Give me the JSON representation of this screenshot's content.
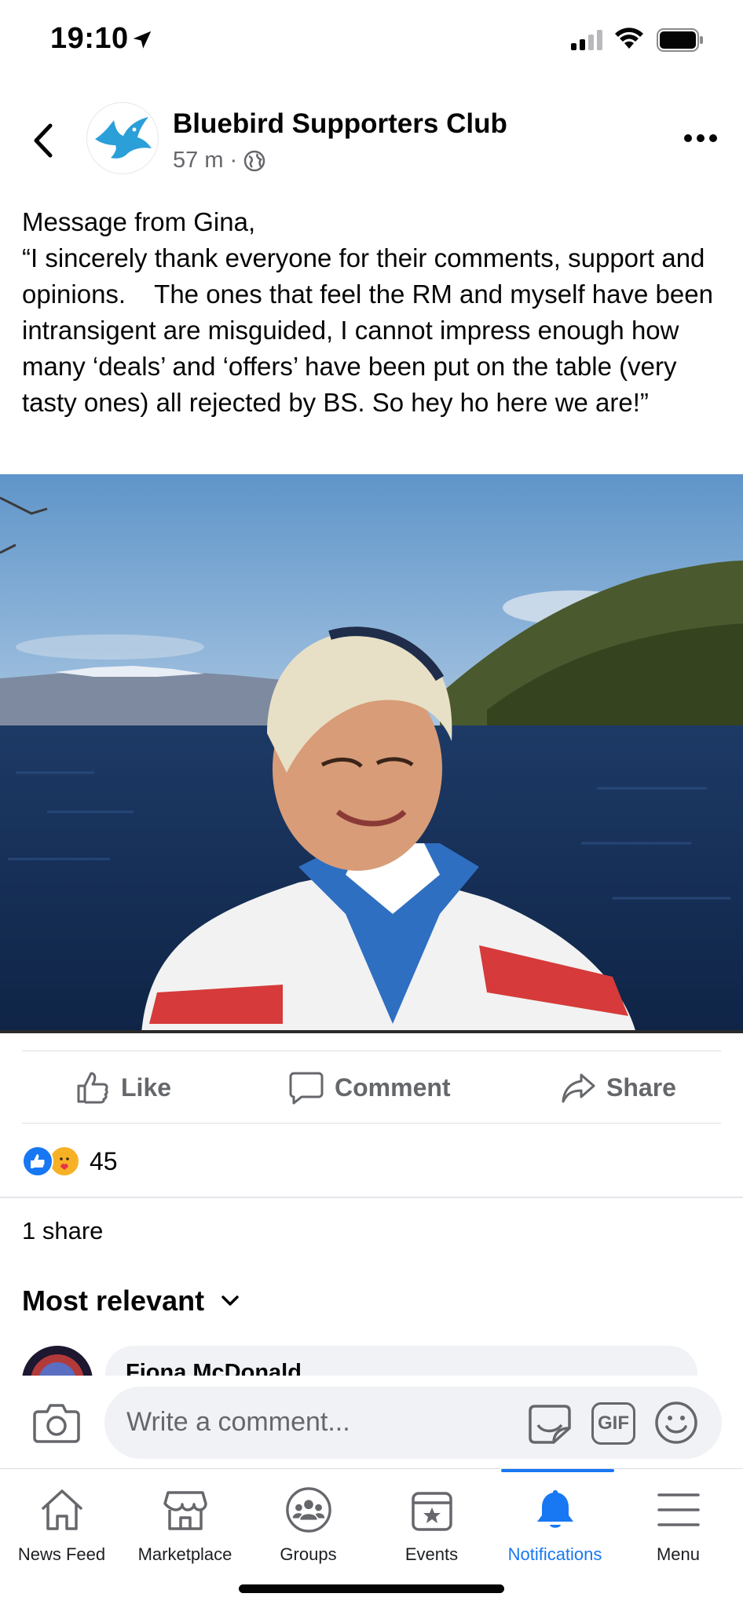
{
  "status_bar": {
    "time": "19:10"
  },
  "post": {
    "page_name": "Bluebird Supporters Club",
    "time_ago": "57 m",
    "separator": "·",
    "text": "Message from Gina,\n“I sincerely thank everyone for their comments, support and opinions.    The ones that feel the RM and myself have been intransigent are misguided, I cannot impress enough how many ‘deals’ and ‘offers’ have been put on the table (very tasty ones) all rejected by BS. So hey ho here we are!”"
  },
  "actions": {
    "like": "Like",
    "comment": "Comment",
    "share": "Share"
  },
  "reactions": {
    "count": "45"
  },
  "shares": "1 share",
  "comments": {
    "sort_label": "Most relevant",
    "first_author": "Fiona McDonald"
  },
  "composer": {
    "placeholder": "Write a comment...",
    "gif_label": "GIF"
  },
  "nav": {
    "items": [
      {
        "label": "News Feed",
        "icon": "home-icon"
      },
      {
        "label": "Marketplace",
        "icon": "marketplace-icon"
      },
      {
        "label": "Groups",
        "icon": "groups-icon"
      },
      {
        "label": "Events",
        "icon": "events-icon"
      },
      {
        "label": "Notifications",
        "icon": "bell-icon"
      },
      {
        "label": "Menu",
        "icon": "hamburger-icon"
      }
    ],
    "active_index": 4
  },
  "colors": {
    "accent": "#1877f2",
    "secondary_text": "#65676b",
    "bubble": "#f0f2f5",
    "brand_bird": "#2a9fd8"
  }
}
